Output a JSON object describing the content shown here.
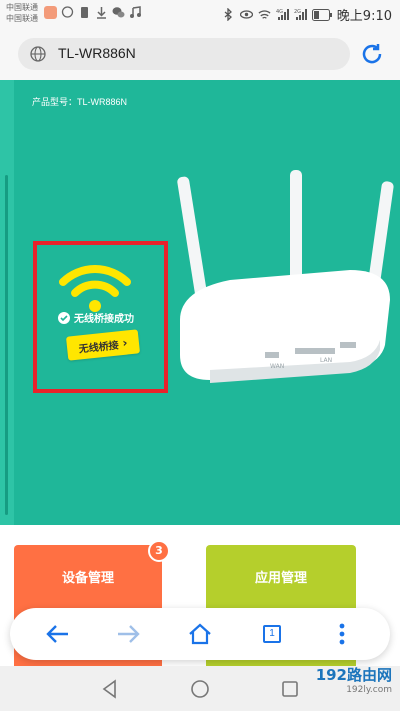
{
  "status_bar": {
    "carrier1": "中国联通",
    "carrier2": "中国联通",
    "network1": "4G",
    "network2": "2G",
    "time": "晚上9:10"
  },
  "browser": {
    "url": "TL-WR886N"
  },
  "page": {
    "model_label": "产品型号：TL-WR886N",
    "success_text": "无线桥接成功",
    "bridge_button": "无线桥接",
    "cards": [
      {
        "title": "设备管理",
        "badge": "3"
      },
      {
        "title": "应用管理"
      }
    ]
  },
  "toolbar": {
    "tab_count": "1"
  },
  "watermark": {
    "name": "192路由网",
    "url": "192ly.com"
  },
  "colors": {
    "teal": "#1fb799",
    "highlight_red": "#e8232b",
    "yellow": "#ffe600",
    "orange_card": "#ff7043",
    "green_card": "#b5cf2c",
    "accent_blue": "#1a73e8"
  }
}
